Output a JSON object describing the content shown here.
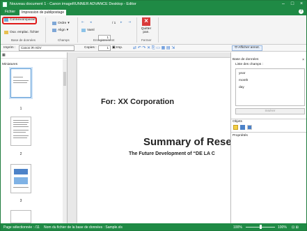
{
  "window": {
    "title": "Nouveau document 1 - Canon imageRUNNER ADVANCE Desktop - Editor"
  },
  "tabs": [
    {
      "label": "Fichier"
    },
    {
      "label": "Impression de publipostage"
    }
  ],
  "ribbon": {
    "groups": {
      "database": {
        "label": "Base de données",
        "items": [
          "Connexion/param.",
          "Ouv. emplac. fichier"
        ]
      },
      "fields": {
        "label": "Champs",
        "items": [
          "Ordre",
          "Align"
        ]
      },
      "records": {
        "label": "Enregistrement",
        "record_value": "1",
        "record_total": "/ 1",
        "view_label": "Vaml"
      },
      "close": {
        "label": "Fermer",
        "button_label": "Quitter pan."
      }
    }
  },
  "toolbar": {
    "printer_label": "Imprim :",
    "printer_value": "Canon iR-ADV",
    "copies_label": "Copies :",
    "copies_value": "1",
    "print_button": "Imp.",
    "annotation_button": "Afficher annot."
  },
  "left_pane": {
    "title": "Miniatures",
    "pages": [
      "1",
      "2",
      "3"
    ]
  },
  "document": {
    "for_text": "For: XX Corporation",
    "summary_text": "Summary of Rese",
    "subtitle_text": "The Future Development of “DE LA C"
  },
  "right_pane": {
    "database_title": "Base de données",
    "fields_list_label": "Liste des champs :",
    "fields": [
      "year",
      "month",
      "day"
    ],
    "insert_button": "Insérer",
    "objects_label": "Objets",
    "properties_label": "Propriétés"
  },
  "status_bar": {
    "page_selected": "Page sélectionnée : /11",
    "database_file": "Nom du fichier de la base de données : Sample.xls",
    "zoom": "100%",
    "zoom_right": "100%"
  },
  "colors": {
    "brand_green": "#1f8a45",
    "highlight_red": "#e01b1b"
  }
}
